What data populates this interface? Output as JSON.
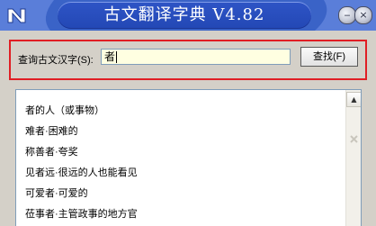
{
  "window": {
    "title": "古文翻译字典 V4.82",
    "icons": {
      "app": "app-logo-icon",
      "minimize": "minimize-icon",
      "close": "close-icon"
    },
    "minimize_glyph": "‒",
    "close_glyph": "×"
  },
  "query": {
    "label": "查询古文汉字(S):",
    "value": "者",
    "find_button": "查找(F)"
  },
  "results": [
    "者的人（或事物）",
    "难者·困难的",
    "称善者·夸奖",
    "见者远·很远的人也能看见",
    "可爱者·可爱的",
    "莅事者·主管政事的地方官"
  ],
  "scrollbar": {
    "up_glyph": "▲"
  },
  "colors": {
    "titlebar": "#2e54c6",
    "frame_highlight": "#e01e24",
    "input_background": "#ffffe1",
    "window_background": "#d4d0c8"
  }
}
